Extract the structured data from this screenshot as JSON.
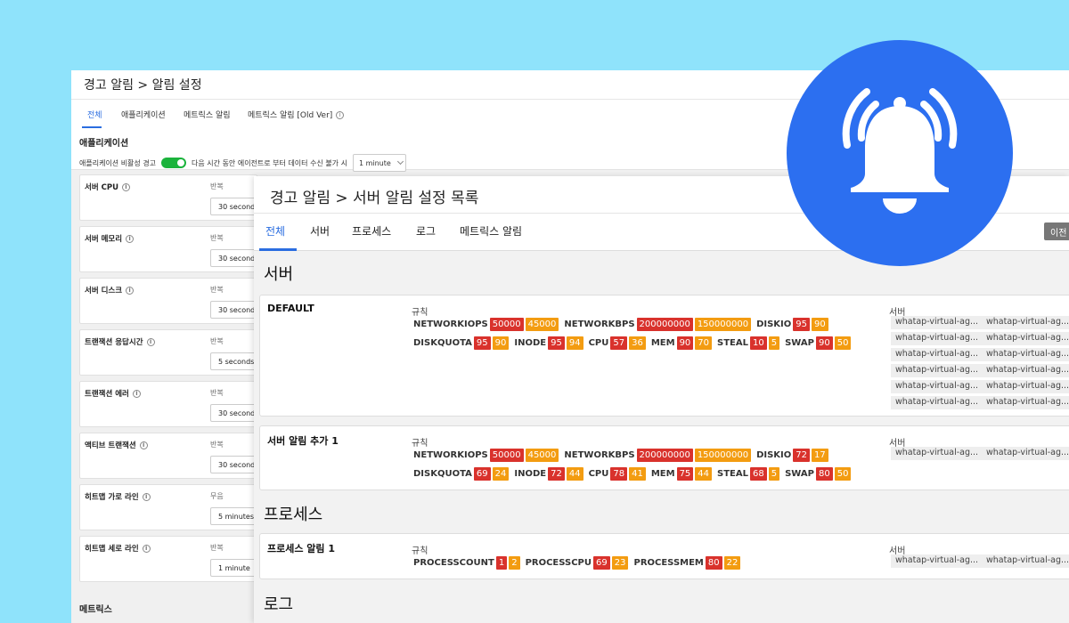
{
  "back_window": {
    "title": "경고 알림 > 알림 설정",
    "tabs": [
      "전체",
      "애플리케이션",
      "메트릭스 알림",
      "메트릭스 알림 [Old Ver]"
    ],
    "info_glyph": "i",
    "section_title": "애플리케이션",
    "inactive_label": "애플리케이션 비활성 경고",
    "inactive_desc": "다음 시간 동안 에이전트로 부터 데이터 수신 불가 시",
    "inactive_value": "1 minute",
    "cards": [
      {
        "label": "서버 CPU",
        "sub": "반복",
        "value": "30 seconds"
      },
      {
        "label": "서버 메모리",
        "sub": "반복",
        "value": "30 seconds"
      },
      {
        "label": "서버 디스크",
        "sub": "반복",
        "value": "30 seconds"
      },
      {
        "label": "트랜잭션 응답시간",
        "sub": "반복",
        "value": "5 seconds"
      },
      {
        "label": "트랜잭션 에러",
        "sub": "반복",
        "value": "30 seconds"
      },
      {
        "label": "액티브 트랜잭션",
        "sub": "반복",
        "value": "30 seconds"
      },
      {
        "label": "히트맵 가로 라인",
        "sub": "무음",
        "value": "5 minutes"
      },
      {
        "label": "히트맵 세로 라인",
        "sub": "반복",
        "value": "1 minute"
      }
    ],
    "metrics_title": "메트릭스"
  },
  "front_window": {
    "title": "경고 알림 > 서버 알림 설정 목록",
    "tabs": [
      "전체",
      "서버",
      "프로세스",
      "로그",
      "메트릭스 알림"
    ],
    "prev_button": "이전",
    "groups": {
      "server": "서버",
      "process": "프로세스",
      "log": "로그"
    },
    "rule_label": "규칙",
    "server_label": "서버",
    "rules": [
      {
        "name": "DEFAULT",
        "lines": [
          [
            {
              "metric": "NETWORKIOPS",
              "crit": "50000",
              "warn": "45000"
            },
            {
              "metric": "NETWORKBPS",
              "crit": "200000000",
              "warn": "150000000"
            },
            {
              "metric": "DISKIO",
              "crit": "95",
              "warn": "90"
            }
          ],
          [
            {
              "metric": "DISKQUOTA",
              "crit": "95",
              "warn": "90"
            },
            {
              "metric": "INODE",
              "crit": "95",
              "warn": "94"
            },
            {
              "metric": "CPU",
              "crit": "57",
              "warn": "36"
            },
            {
              "metric": "MEM",
              "crit": "90",
              "warn": "70"
            },
            {
              "metric": "STEAL",
              "crit": "10",
              "warn": "5"
            },
            {
              "metric": "SWAP",
              "crit": "90",
              "warn": "50"
            }
          ]
        ],
        "servers": [
          "whatap-virtual-ag...",
          "whatap-virtual-ag...",
          "whatap-virtual-ag...",
          "whatap-virtual-ag...",
          "whatap-virtual-ag...",
          "whatap-virtual-ag...",
          "whatap-virtual-ag...",
          "whatap-virtual-ag...",
          "whatap-virtual-ag...",
          "whatap-virtual-ag...",
          "whatap-virtual-ag...",
          "whatap-virtual-ag..."
        ]
      },
      {
        "name": "서버 알림 추가 1",
        "lines": [
          [
            {
              "metric": "NETWORKIOPS",
              "crit": "50000",
              "warn": "45000"
            },
            {
              "metric": "NETWORKBPS",
              "crit": "200000000",
              "warn": "150000000"
            },
            {
              "metric": "DISKIO",
              "crit": "72",
              "warn": "17"
            }
          ],
          [
            {
              "metric": "DISKQUOTA",
              "crit": "69",
              "warn": "24"
            },
            {
              "metric": "INODE",
              "crit": "72",
              "warn": "44"
            },
            {
              "metric": "CPU",
              "crit": "78",
              "warn": "41"
            },
            {
              "metric": "MEM",
              "crit": "75",
              "warn": "44"
            },
            {
              "metric": "STEAL",
              "crit": "68",
              "warn": "5"
            },
            {
              "metric": "SWAP",
              "crit": "80",
              "warn": "50"
            }
          ]
        ],
        "servers": [
          "whatap-virtual-ag...",
          "whatap-virtual-ag..."
        ]
      },
      {
        "name": "프로세스 알림 1",
        "lines": [
          [
            {
              "metric": "PROCESSCOUNT",
              "crit": "1",
              "warn": "2"
            },
            {
              "metric": "PROCESSCPU",
              "crit": "69",
              "warn": "23"
            },
            {
              "metric": "PROCESSMEM",
              "crit": "80",
              "warn": "22"
            }
          ]
        ],
        "servers": [
          "whatap-virtual-ag...",
          "whatap-virtual-ag..."
        ]
      }
    ]
  },
  "colors": {
    "background": "#8fe3fb",
    "accent": "#2a6de0",
    "critical": "#d9322c",
    "warning": "#f39c11",
    "toggle_on": "#1bb33c",
    "bell_circle": "#2c6ff0"
  },
  "icons": {
    "bell": "bell-ringing-icon",
    "info": "info-icon",
    "dropdown": "chevron-down-icon"
  }
}
